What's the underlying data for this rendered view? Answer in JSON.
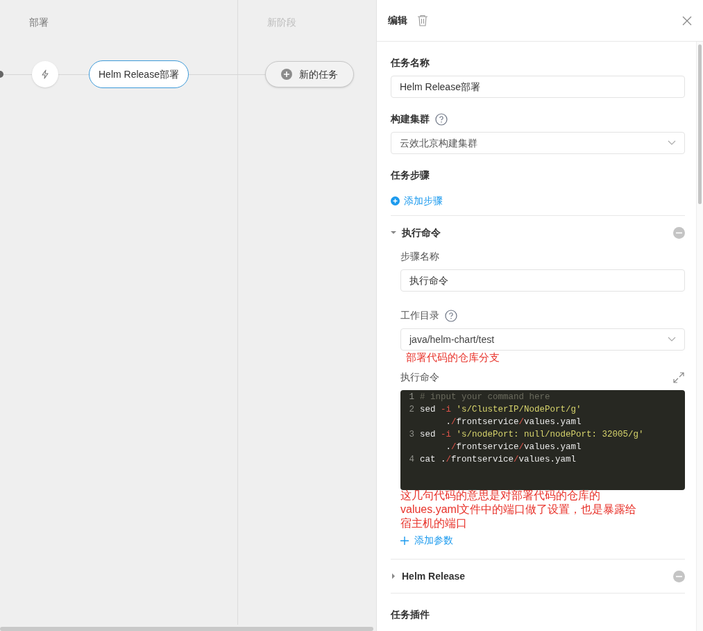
{
  "canvas": {
    "stages": [
      {
        "title": "部署",
        "selected": true
      },
      {
        "title": "新阶段",
        "selected": false
      }
    ],
    "task_node": {
      "label": "Helm Release部署",
      "selected": true
    },
    "new_task_button": {
      "label": "新的任务"
    }
  },
  "panel": {
    "title": "编辑",
    "fields": [
      {
        "label": "任务名称",
        "kind": "text",
        "value": "Helm Release部署",
        "help": false
      },
      {
        "label": "构建集群",
        "kind": "select",
        "value": "云效北京构建集群",
        "help": true
      }
    ],
    "steps_heading": "任务步骤",
    "add_step": "添加步骤",
    "steps": [
      {
        "title": "执行命令",
        "expanded": true,
        "name_label": "步骤名称",
        "name_value": "执行命令",
        "dir_label": "工作目录",
        "dir_value": "java/helm-chart/test",
        "dir_note": "部署代码的仓库分支",
        "command_label": "执行命令",
        "code_lines": [
          {
            "number": "1",
            "tokens": [
              {
                "text": "# input your command here",
                "kind": "comment"
              }
            ]
          },
          {
            "number": "2",
            "tokens": [
              {
                "text": "sed ",
                "kind": "plain"
              },
              {
                "text": "-i",
                "kind": "op"
              },
              {
                "text": " 's/ClusterIP/NodePort/g'",
                "kind": "string"
              },
              {
                "text": " .",
                "kind": "plain"
              },
              {
                "text": "/",
                "kind": "op"
              },
              {
                "text": "frontservice",
                "kind": "plain"
              },
              {
                "text": "/",
                "kind": "op"
              },
              {
                "text": "values.yaml",
                "kind": "plain"
              }
            ]
          },
          {
            "number": "3",
            "tokens": [
              {
                "text": "sed ",
                "kind": "plain"
              },
              {
                "text": "-i",
                "kind": "op"
              },
              {
                "text": " 's/nodePort: null/nodePort: 32005/g'",
                "kind": "string"
              },
              {
                "text": " .",
                "kind": "plain"
              },
              {
                "text": "/",
                "kind": "op"
              },
              {
                "text": "frontservice",
                "kind": "plain"
              },
              {
                "text": "/",
                "kind": "op"
              },
              {
                "text": "values.yaml",
                "kind": "plain"
              }
            ]
          },
          {
            "number": "4",
            "tokens": [
              {
                "text": "cat .",
                "kind": "plain"
              },
              {
                "text": "/",
                "kind": "op"
              },
              {
                "text": "frontservice",
                "kind": "plain"
              },
              {
                "text": "/",
                "kind": "op"
              },
              {
                "text": "values.yaml",
                "kind": "plain"
              }
            ]
          }
        ],
        "command_note": "这几句代码的意思是对部署代码的仓库的values.yaml文件中的端口做了设置，也是暴露给宿主机的端口",
        "add_param": "添加参数"
      },
      {
        "title": "Helm Release",
        "expanded": false
      }
    ],
    "plugins_heading": "任务插件"
  }
}
